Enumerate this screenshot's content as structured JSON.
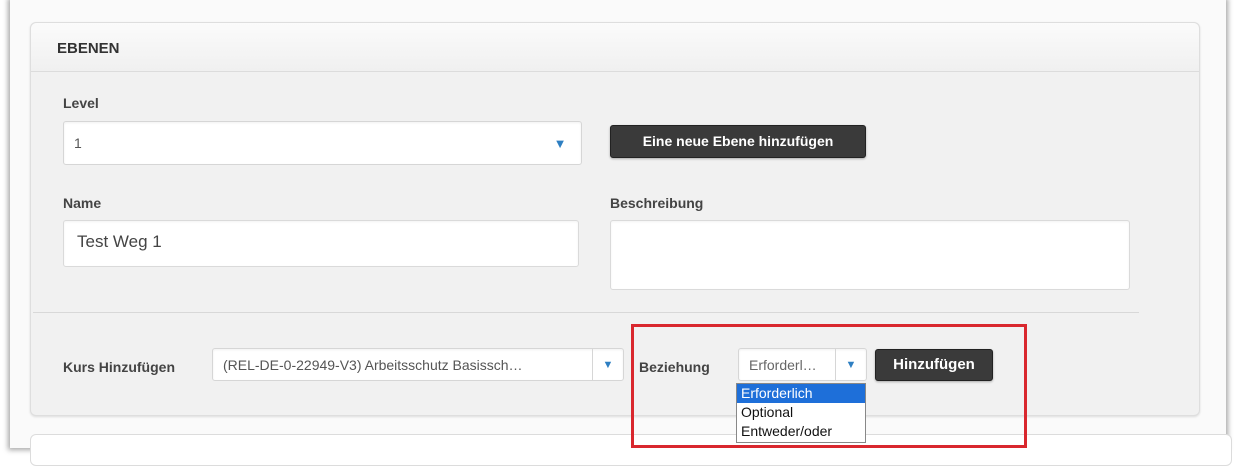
{
  "panel": {
    "title": "EBENEN"
  },
  "level": {
    "label": "Level",
    "value": "1",
    "add_button": "Eine neue Ebene hinzufügen"
  },
  "name": {
    "label": "Name",
    "value": "Test Weg 1"
  },
  "description": {
    "label": "Beschreibung",
    "value": ""
  },
  "course": {
    "label": "Kurs Hinzufügen",
    "value": "(REL-DE-0-22949-V3) Arbeitsschutz Basissch…"
  },
  "relation": {
    "label": "Beziehung",
    "value": "Erforderl…",
    "options": [
      "Erforderlich",
      "Optional",
      "Entweder/oder"
    ],
    "selected_index": 0,
    "add_button": "Hinzufügen"
  },
  "icons": {
    "dropdown_arrow": "▼"
  },
  "colors": {
    "highlight": "#d9272e",
    "selected_option": "#1e6fd9",
    "arrow": "#2e7fc2"
  }
}
